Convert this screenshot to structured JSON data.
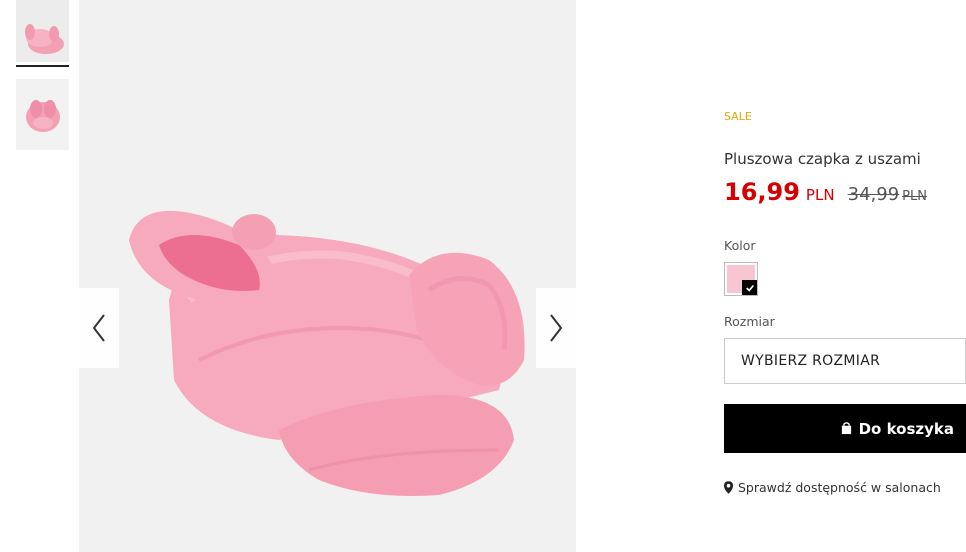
{
  "gallery": {
    "thumbnails": [
      {
        "alt": "thumbnail-1",
        "selected": true
      },
      {
        "alt": "thumbnail-2",
        "selected": false
      }
    ],
    "prev_icon": "chevron-left-icon",
    "next_icon": "chevron-right-icon"
  },
  "product": {
    "badge": "SALE",
    "title": "Pluszowa czapka z uszami",
    "price": "16,99",
    "currency": "PLN",
    "old_price": "34,99",
    "old_currency": "PLN",
    "colors": {
      "badge": "#e0a800",
      "price": "#d50000",
      "swatch": "#f7c6d2"
    }
  },
  "options": {
    "color_label": "Kolor",
    "size_label": "Rozmiar",
    "size_placeholder": "WYBIERZ ROZMIAR"
  },
  "actions": {
    "add_to_cart": "Do koszyka",
    "check_availability": "Sprawdź dostępność w salonach"
  }
}
